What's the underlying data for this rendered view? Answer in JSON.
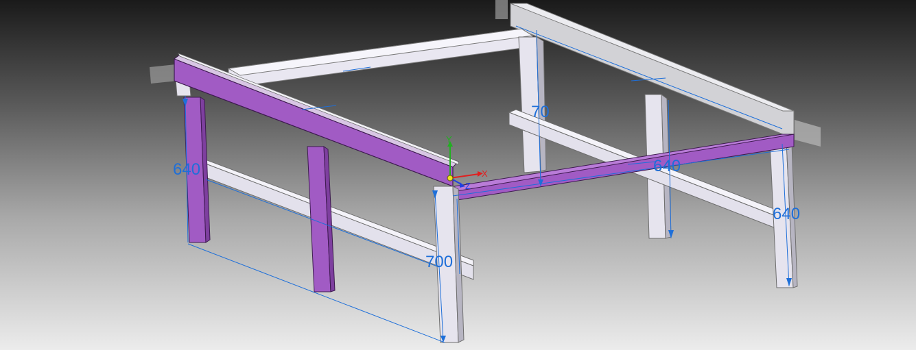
{
  "viewport": {
    "app": "CAD 3D model view"
  },
  "colors": {
    "background_top": "#1a1a1a",
    "background_bottom": "#ececec",
    "beam_light": "#e8e6ef",
    "beam_shade": "#b9b7c3",
    "selected_purple": "#a15bc4",
    "dimension_blue": "#1e6fd9",
    "axis_x": "#e02020",
    "axis_y": "#20b020",
    "axis_z": "#2040e0",
    "ref_plane": "#bdbdbd"
  },
  "dimensions": {
    "left_post_height": "640",
    "front_post_height": "700",
    "rear_top_height": "70",
    "front_right_rail": "640",
    "right_post_height": "640"
  },
  "triad": {
    "x_label": "X",
    "y_label": "Y",
    "z_label": "Z"
  }
}
